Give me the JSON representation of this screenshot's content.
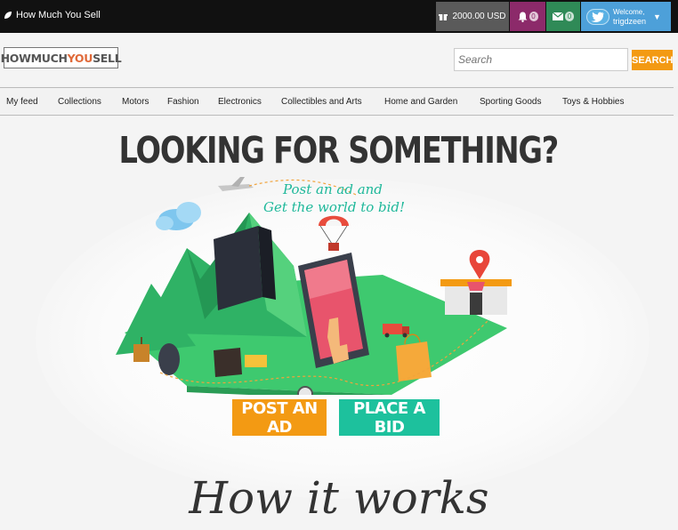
{
  "topbar": {
    "site_name": "How Much You Sell",
    "balance": "2000.00 USD",
    "notifications_count": "0",
    "messages_count": "0",
    "welcome_label": "Welcome,",
    "username": "trigdzeen"
  },
  "header": {
    "logo_part1": "HOWMUCH",
    "logo_part2": "YOU",
    "logo_part3": "SELL",
    "search_placeholder": "Search",
    "search_button": "SEARCH"
  },
  "nav": {
    "items": [
      "My feed",
      "Collections",
      "Motors",
      "Fashion",
      "Electronics",
      "Collectibles and Arts",
      "Home and Garden",
      "Sporting Goods",
      "Toys & Hobbies"
    ]
  },
  "hero": {
    "title": "LOOKING FOR SOMETHING?",
    "tagline_line1": "Post an ad and",
    "tagline_line2": "Get the world to bid!",
    "post_button": "POST AN AD",
    "bid_button": "PLACE A BID",
    "how_title": "How it works"
  },
  "colors": {
    "topbar_bg": "#111111",
    "balance_bg": "#5a5a5a",
    "notifications_bg": "#8c2a6a",
    "messages_bg": "#2f8a57",
    "user_bg": "#4da0d9",
    "accent_orange": "#f39a13",
    "accent_teal": "#1dc19d"
  },
  "icons": [
    "leaf-icon",
    "gift-icon",
    "bell-icon",
    "envelope-icon",
    "twitter-bird-icon",
    "chevron-down-icon"
  ]
}
